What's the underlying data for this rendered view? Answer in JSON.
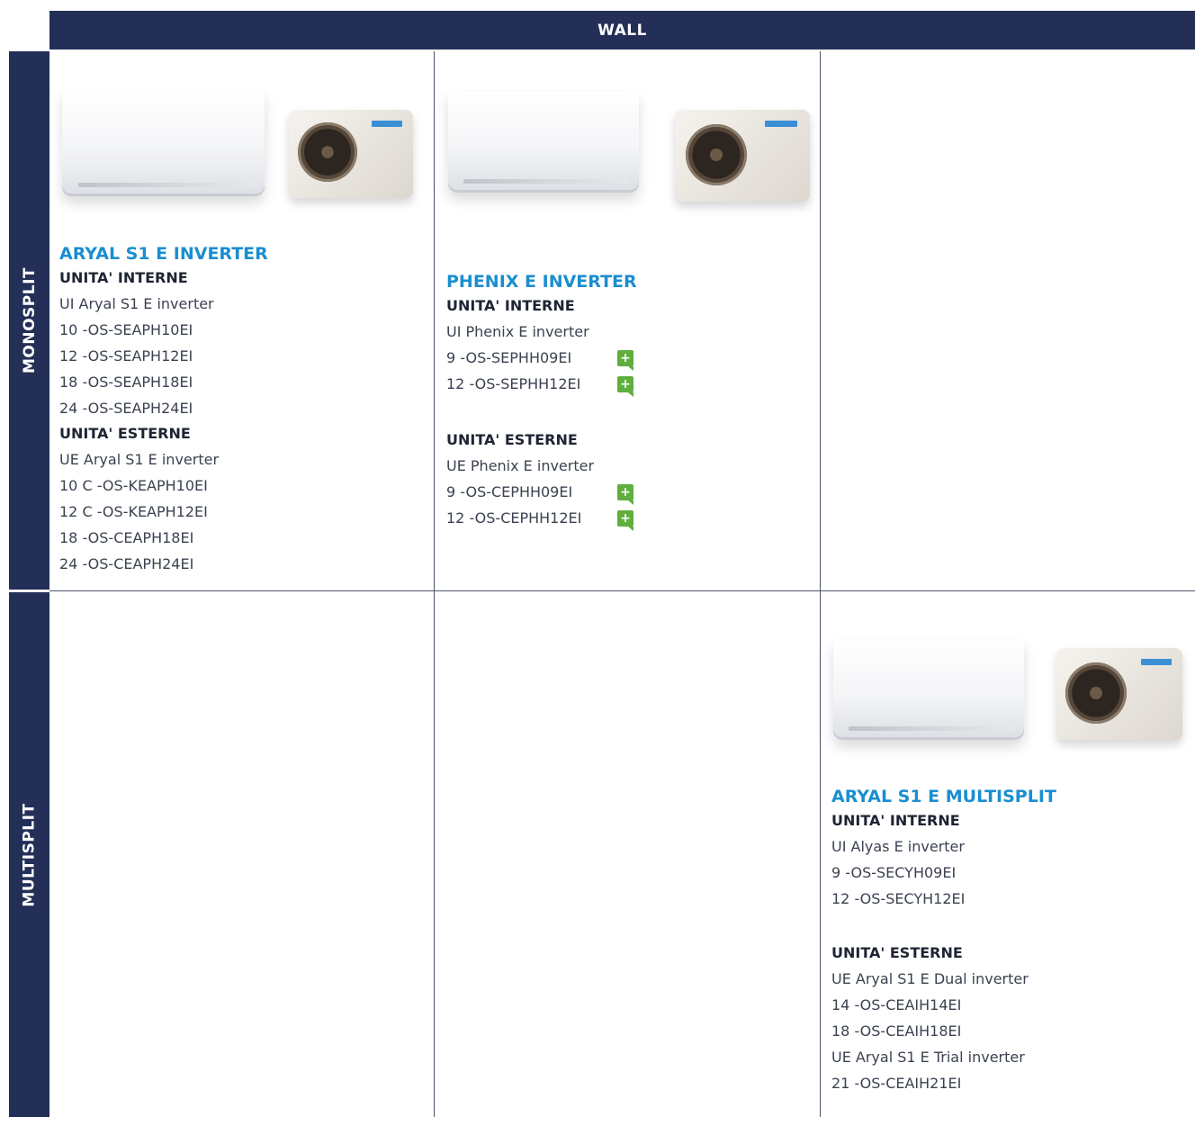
{
  "header": {
    "wall": "WALL"
  },
  "rows": {
    "monosplit": "MONOSPLIT",
    "multisplit": "MULTISPLIT"
  },
  "products": {
    "aryal_inverter": {
      "title": "ARYAL S1 E INVERTER",
      "internal_label": "UNITA' INTERNE",
      "internal": [
        "UI Aryal S1 E inverter",
        "10 -OS-SEAPH10EI",
        "12 -OS-SEAPH12EI",
        "18 -OS-SEAPH18EI",
        "24 -OS-SEAPH24EI"
      ],
      "external_label": "UNITA' ESTERNE",
      "external": [
        "UE Aryal S1 E inverter",
        "10 C -OS-KEAPH10EI",
        "12 C -OS-KEAPH12EI",
        "18 -OS-CEAPH18EI",
        "24 -OS-CEAPH24EI"
      ]
    },
    "phenix_inverter": {
      "title": "PHENIX E INVERTER",
      "internal_label": "UNITA' INTERNE",
      "internal": [
        "UI Phenix E inverter",
        "9 -OS-SEPHH09EI",
        "12 -OS-SEPHH12EI"
      ],
      "external_label": "UNITA' ESTERNE",
      "external": [
        "UE Phenix E inverter",
        "9 -OS-CEPHH09EI",
        "12 -OS-CEPHH12EI"
      ],
      "plus_symbol": "+"
    },
    "aryal_multisplit": {
      "title": "ARYAL S1 E MULTISPLIT",
      "internal_label": "UNITA' INTERNE",
      "internal": [
        "UI Alyas E inverter",
        "9 -OS-SECYH09EI",
        "12 -OS-SECYH12EI"
      ],
      "external_label": "UNITA' ESTERNE",
      "external": [
        "UE Aryal S1 E Dual inverter",
        "14 -OS-CEAIH14EI",
        "18 -OS-CEAIH18EI",
        "UE Aryal S1 E Trial inverter",
        "21 -OS-CEAIH21EI"
      ]
    }
  },
  "colors": {
    "navy": "#232f56",
    "title_blue": "#1a8ed0",
    "plus_green": "#5fae3e"
  }
}
